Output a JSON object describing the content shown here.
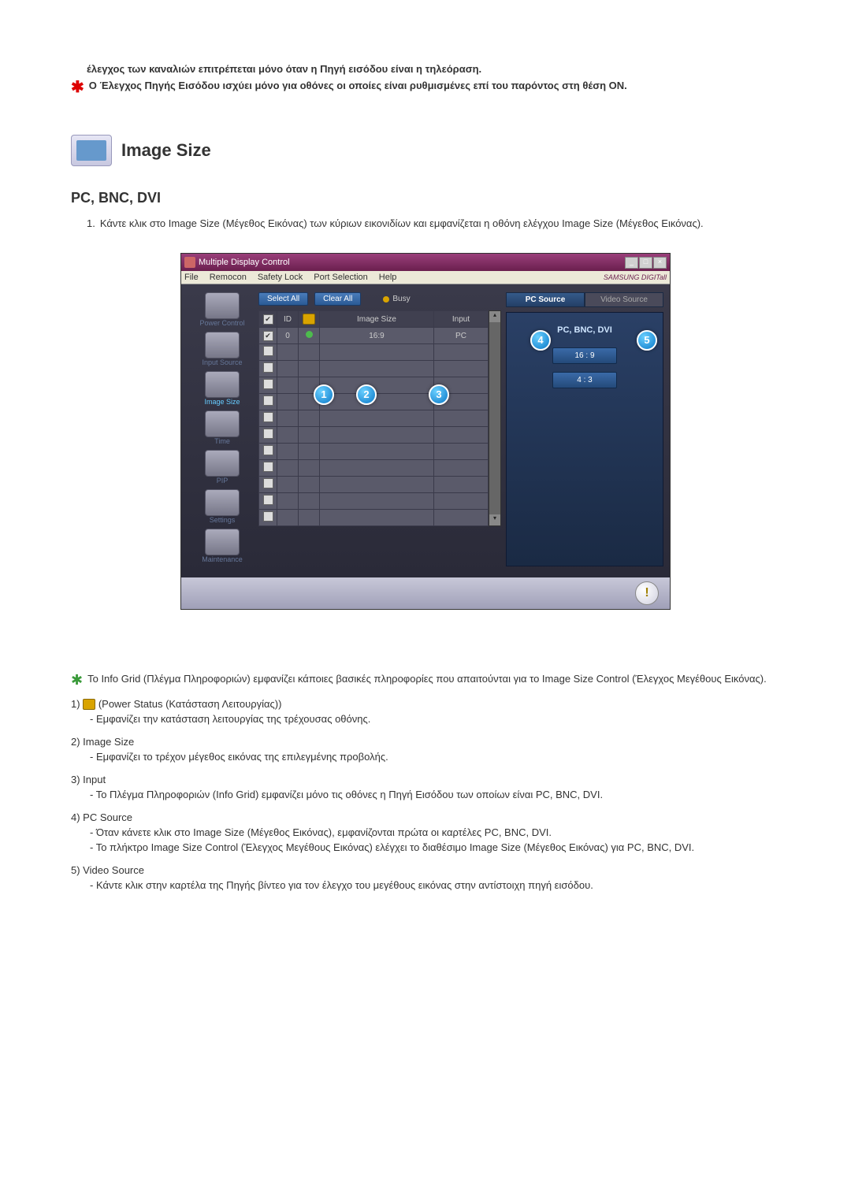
{
  "intro": {
    "line1": "έλεγχος των καναλιών επιτρέπεται μόνο όταν η Πηγή εισόδου είναι η τηλεόραση.",
    "starline": "Ο Έλεγχος Πηγής Εισόδου ισχύει μόνο για οθόνες οι οποίες είναι ρυθμισμένες επί του παρόντος στη θέση ON."
  },
  "section": {
    "title": "Image Size",
    "subtitle": "PC, BNC, DVI",
    "step_num": "1.",
    "step_text": "Κάντε κλικ στο Image Size (Μέγεθος Εικόνας) των κύριων εικονιδίων και εμφανίζεται η οθόνη ελέγχου Image Size (Μέγεθος Εικόνας)."
  },
  "app": {
    "title": "Multiple Display Control",
    "menu": [
      "File",
      "Remocon",
      "Safety Lock",
      "Port Selection",
      "Help"
    ],
    "brand": "SAMSUNG DIGITall",
    "select_all": "Select All",
    "clear_all": "Clear All",
    "busy": "Busy",
    "sidebar": [
      "Power Control",
      "Input Source",
      "Image Size",
      "Time",
      "PIP",
      "Settings",
      "Maintenance"
    ],
    "headers": {
      "cb": "☑",
      "id": "ID",
      "pw": "⏻",
      "imgsize": "Image Size",
      "input": "Input"
    },
    "row0": {
      "id": "0",
      "imgsize": "16:9",
      "input": "PC"
    },
    "tabs": {
      "pc": "PC Source",
      "video": "Video Source"
    },
    "panel_title": "PC, BNC, DVI",
    "ratio1": "16 : 9",
    "ratio2": "4 : 3",
    "callouts": {
      "c1": "1",
      "c2": "2",
      "c3": "3",
      "c4": "4",
      "c5": "5"
    }
  },
  "notes": {
    "star": "Το Info Grid (Πλέγμα Πληροφοριών) εμφανίζει κάποιες βασικές πληροφορίες που απαιτούνται για το Image Size Control (Έλεγχος Μεγέθους Εικόνας).",
    "n1_head": "1)",
    "n1_label": "(Power Status (Κατάσταση Λειτουργίας))",
    "n1_sub": "- Εμφανίζει την κατάσταση λειτουργίας της τρέχουσας οθόνης.",
    "n2_head": "2)  Image Size",
    "n2_sub": "- Εμφανίζει το τρέχον μέγεθος εικόνας της επιλεγμένης προβολής.",
    "n3_head": "3)  Input",
    "n3_sub": "- Το Πλέγμα Πληροφοριών (Info Grid) εμφανίζει μόνο τις οθόνες η Πηγή Εισόδου των οποίων είναι PC, BNC, DVI.",
    "n4_head": "4)  PC Source",
    "n4_sub1": "- Όταν κάνετε κλικ στο Image Size (Μέγεθος Εικόνας), εμφανίζονται πρώτα οι καρτέλες PC, BNC, DVI.",
    "n4_sub2": "- Το πλήκτρο Image Size Control (Έλεγχος Μεγέθους Εικόνας) ελέγχει το διαθέσιμο Image Size (Μέγεθος Εικόνας) για PC, BNC, DVI.",
    "n5_head": "5)  Video Source",
    "n5_sub": "- Κάντε κλικ στην καρτέλα της Πηγής βίντεο για τον έλεγχο του μεγέθους εικόνας στην αντίστοιχη πηγή εισόδου."
  }
}
